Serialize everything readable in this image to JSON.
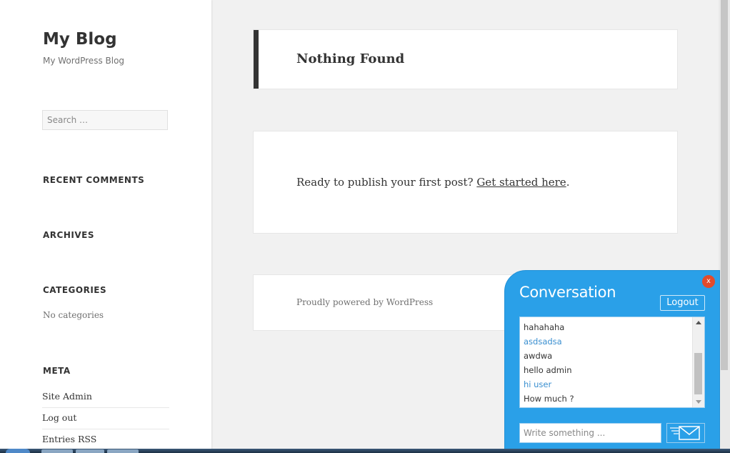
{
  "site": {
    "title": "My Blog",
    "description": "My WordPress Blog"
  },
  "search": {
    "placeholder": "Search …"
  },
  "widgets": {
    "recent_comments": "RECENT COMMENTS",
    "archives": "ARCHIVES",
    "categories": "CATEGORIES",
    "categories_text": "No categories",
    "meta": "META",
    "meta_links": [
      "Site Admin",
      "Log out",
      "Entries RSS"
    ]
  },
  "main": {
    "nothing_found": "Nothing Found",
    "ready_text": "Ready to publish your first post?",
    "get_started": "Get started here",
    "period": ".",
    "footer": "Proudly powered by WordPress"
  },
  "chat": {
    "title": "Conversation",
    "close": "x",
    "logout": "Logout",
    "messages": [
      {
        "text": "hahahaha",
        "style": "default"
      },
      {
        "text": "asdsadsa",
        "style": "alt"
      },
      {
        "text": "awdwa",
        "style": "default"
      },
      {
        "text": "hello admin",
        "style": "default"
      },
      {
        "text": "hi user",
        "style": "alt"
      },
      {
        "text": "How much ?",
        "style": "default"
      }
    ],
    "input_placeholder": "Write something ..."
  },
  "colors": {
    "chat_bg": "#2aa0e8",
    "alt_message": "#3a8fd0",
    "close_button": "#e24b2c"
  }
}
